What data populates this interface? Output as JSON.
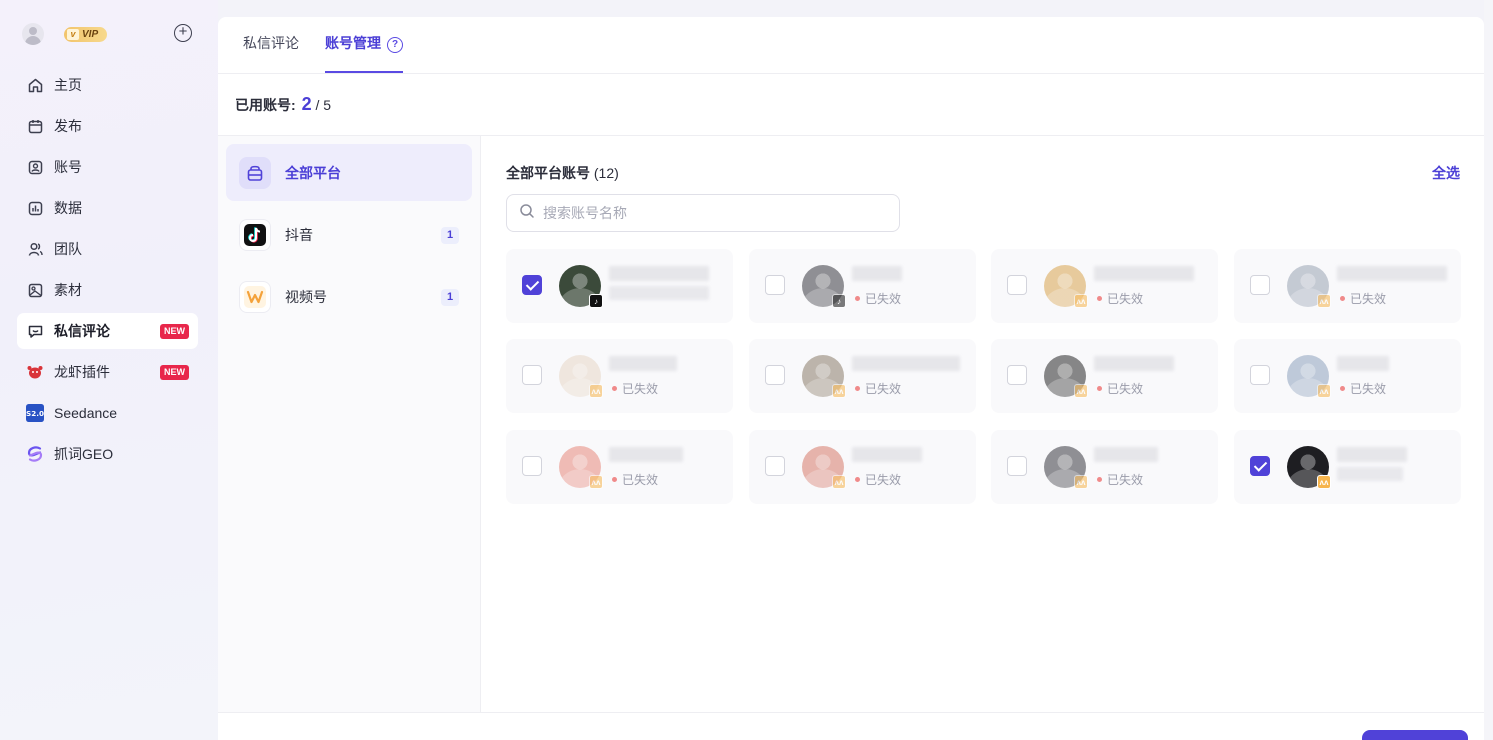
{
  "sidebar": {
    "vip_label": "VIP",
    "vip_v": "v",
    "items": [
      {
        "label": "主页",
        "icon": "home-icon"
      },
      {
        "label": "发布",
        "icon": "calendar-icon"
      },
      {
        "label": "账号",
        "icon": "user-card-icon"
      },
      {
        "label": "数据",
        "icon": "chart-icon"
      },
      {
        "label": "团队",
        "icon": "team-icon"
      },
      {
        "label": "素材",
        "icon": "material-icon"
      },
      {
        "label": "私信评论",
        "icon": "message-icon",
        "badge": "NEW",
        "active": true
      },
      {
        "label": "龙虾插件",
        "icon": "lobster-icon",
        "badge": "NEW"
      },
      {
        "label": "Seedance",
        "icon": "seedance-icon"
      },
      {
        "label": "抓词GEO",
        "icon": "geo-icon"
      }
    ]
  },
  "tabs": [
    {
      "label": "私信评论"
    },
    {
      "label": "账号管理",
      "active": true,
      "help": "?"
    }
  ],
  "usage": {
    "label": "已用账号:",
    "used": "2",
    "total": "/ 5"
  },
  "platforms": [
    {
      "label": "全部平台",
      "active": true,
      "icon": "all-platform-icon"
    },
    {
      "label": "抖音",
      "count": "1",
      "icon": "douyin-icon"
    },
    {
      "label": "视频号",
      "count": "1",
      "icon": "shipinhao-icon"
    }
  ],
  "accounts": {
    "title": "全部平台账号",
    "count": "(12)",
    "select_all": "全选",
    "search_placeholder": "搜索账号名称",
    "status_expired": "已失效",
    "cards": [
      {
        "checked": true,
        "platform": "douyin",
        "expired": false,
        "avatar_color": "#3b4a3a"
      },
      {
        "checked": false,
        "platform": "douyin",
        "expired": true,
        "avatar_color": "#3a3a40"
      },
      {
        "checked": false,
        "platform": "shipinhao",
        "expired": true,
        "avatar_color": "#d9a550"
      },
      {
        "checked": false,
        "platform": "shipinhao",
        "expired": true,
        "avatar_color": "#9aa4b4"
      },
      {
        "checked": false,
        "platform": "shipinhao",
        "expired": true,
        "avatar_color": "#e7d8c8"
      },
      {
        "checked": false,
        "platform": "shipinhao",
        "expired": true,
        "avatar_color": "#8b7d6a"
      },
      {
        "checked": false,
        "platform": "shipinhao",
        "expired": true,
        "avatar_color": "#2a2a2a"
      },
      {
        "checked": false,
        "platform": "shipinhao",
        "expired": true,
        "avatar_color": "#8fa3be"
      },
      {
        "checked": false,
        "platform": "shipinhao",
        "expired": true,
        "avatar_color": "#e78a7d"
      },
      {
        "checked": false,
        "platform": "shipinhao",
        "expired": true,
        "avatar_color": "#d77b6b"
      },
      {
        "checked": false,
        "platform": "shipinhao",
        "expired": true,
        "avatar_color": "#3a3a40"
      },
      {
        "checked": true,
        "platform": "shipinhao",
        "expired": false,
        "avatar_color": "#1e1e22"
      }
    ]
  },
  "colors": {
    "accent": "#5042d8",
    "new_badge": "#e8274b",
    "expired_dot": "#f08a8a"
  }
}
